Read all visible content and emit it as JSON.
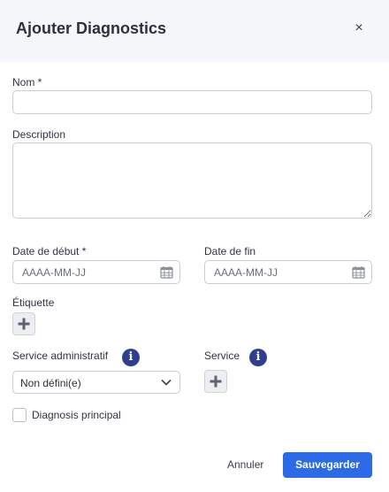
{
  "dialog": {
    "title": "Ajouter Diagnostics",
    "close_glyph": "×"
  },
  "fields": {
    "name": {
      "label": "Nom *",
      "value": ""
    },
    "description": {
      "label": "Description",
      "value": ""
    },
    "start_date": {
      "label": "Date de début *",
      "placeholder": "AAAA-MM-JJ"
    },
    "end_date": {
      "label": "Date de fin",
      "placeholder": "AAAA-MM-JJ"
    },
    "tag": {
      "label": "Étiquette"
    },
    "admin_service": {
      "label": "Service administratif",
      "value": "Non défini(e)",
      "info_glyph": "i"
    },
    "service": {
      "label": "Service",
      "info_glyph": "i"
    },
    "primary_diagnosis": {
      "label": "Diagnosis principal",
      "checked": false
    }
  },
  "footer": {
    "cancel_label": "Annuler",
    "save_label": "Sauvegarder"
  },
  "colors": {
    "primary": "#2d6ae6",
    "info_badge": "#2e3f8f",
    "header_bg": "#f5f7fa"
  },
  "icons": {
    "close": "close-icon",
    "calendar": "calendar-icon",
    "add": "plus-icon",
    "info": "info-icon",
    "dropdown": "chevron-down-icon"
  }
}
